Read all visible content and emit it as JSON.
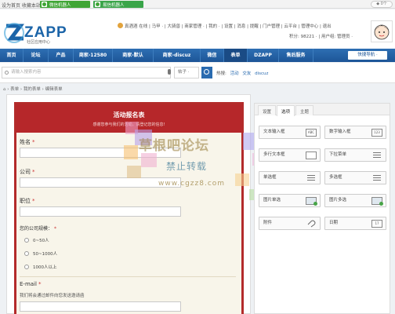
{
  "topbar": {
    "left_links": "设为首页 收藏本站",
    "wechat_bot": "微信机器人",
    "ai_bot": "易信机器人",
    "badge": "◆ 0个"
  },
  "header": {
    "logo_text": "ZAPP",
    "logo_sub": "社区应用中心",
    "username": "真酒酒",
    "user_links": "在线 | 马甲 · | 大骑兽 | 商家管理 · | 我的 · | 设置 | 消息 | 提醒 | 门户管理 | 云平台 | 管理中心 | 退出",
    "points": "积分: 98221 · | 用户组: 管理员 ·"
  },
  "nav": {
    "items": [
      "首页",
      "论坛",
      "产品",
      "商家-12580",
      "商家-默认",
      "商家-discuz",
      "微信",
      "表单",
      "DZAPP",
      "售后服务"
    ],
    "quick": "快捷导航 ·"
  },
  "search": {
    "placeholder": "请输入搜索内容",
    "type": "帖子 ·",
    "hot_label": "热搜:",
    "hot_terms": [
      "活动",
      "交友",
      "discuz"
    ]
  },
  "breadcrumb": "⌂ › 表单 › 我的表单 › 编辑表单",
  "form": {
    "title": "活动报名表",
    "subtitle": "感谢您参与我们的活动，请登记您的信息!",
    "fields": {
      "name": "姓名",
      "company": "公司",
      "position": "职位",
      "scale": "您的公司规模：",
      "email": "E-mail",
      "email_hint": "我们将会通过邮件向您发送邀请函"
    },
    "required_mark": "*",
    "scale_options": [
      "0~50人",
      "50~1000人",
      "1000人以上"
    ]
  },
  "watermark": {
    "line1": "草根吧论坛",
    "line2": "禁止转载",
    "line3": "www.cgzz8.com"
  },
  "sidepanel": {
    "tabs": [
      "设置",
      "选项",
      "主题"
    ],
    "buttons": [
      {
        "label": "文本输入框",
        "icon": "ABC"
      },
      {
        "label": "数字输入框",
        "icon": "123"
      },
      {
        "label": "多行文本框",
        "icon": ""
      },
      {
        "label": "下拉菜单",
        "icon": ""
      },
      {
        "label": "单选框",
        "icon": ""
      },
      {
        "label": "多选框",
        "icon": ""
      },
      {
        "label": "图片单选",
        "icon": ""
      },
      {
        "label": "图片多选",
        "icon": ""
      },
      {
        "label": "附件",
        "icon": ""
      },
      {
        "label": "日期",
        "icon": "17"
      }
    ]
  }
}
